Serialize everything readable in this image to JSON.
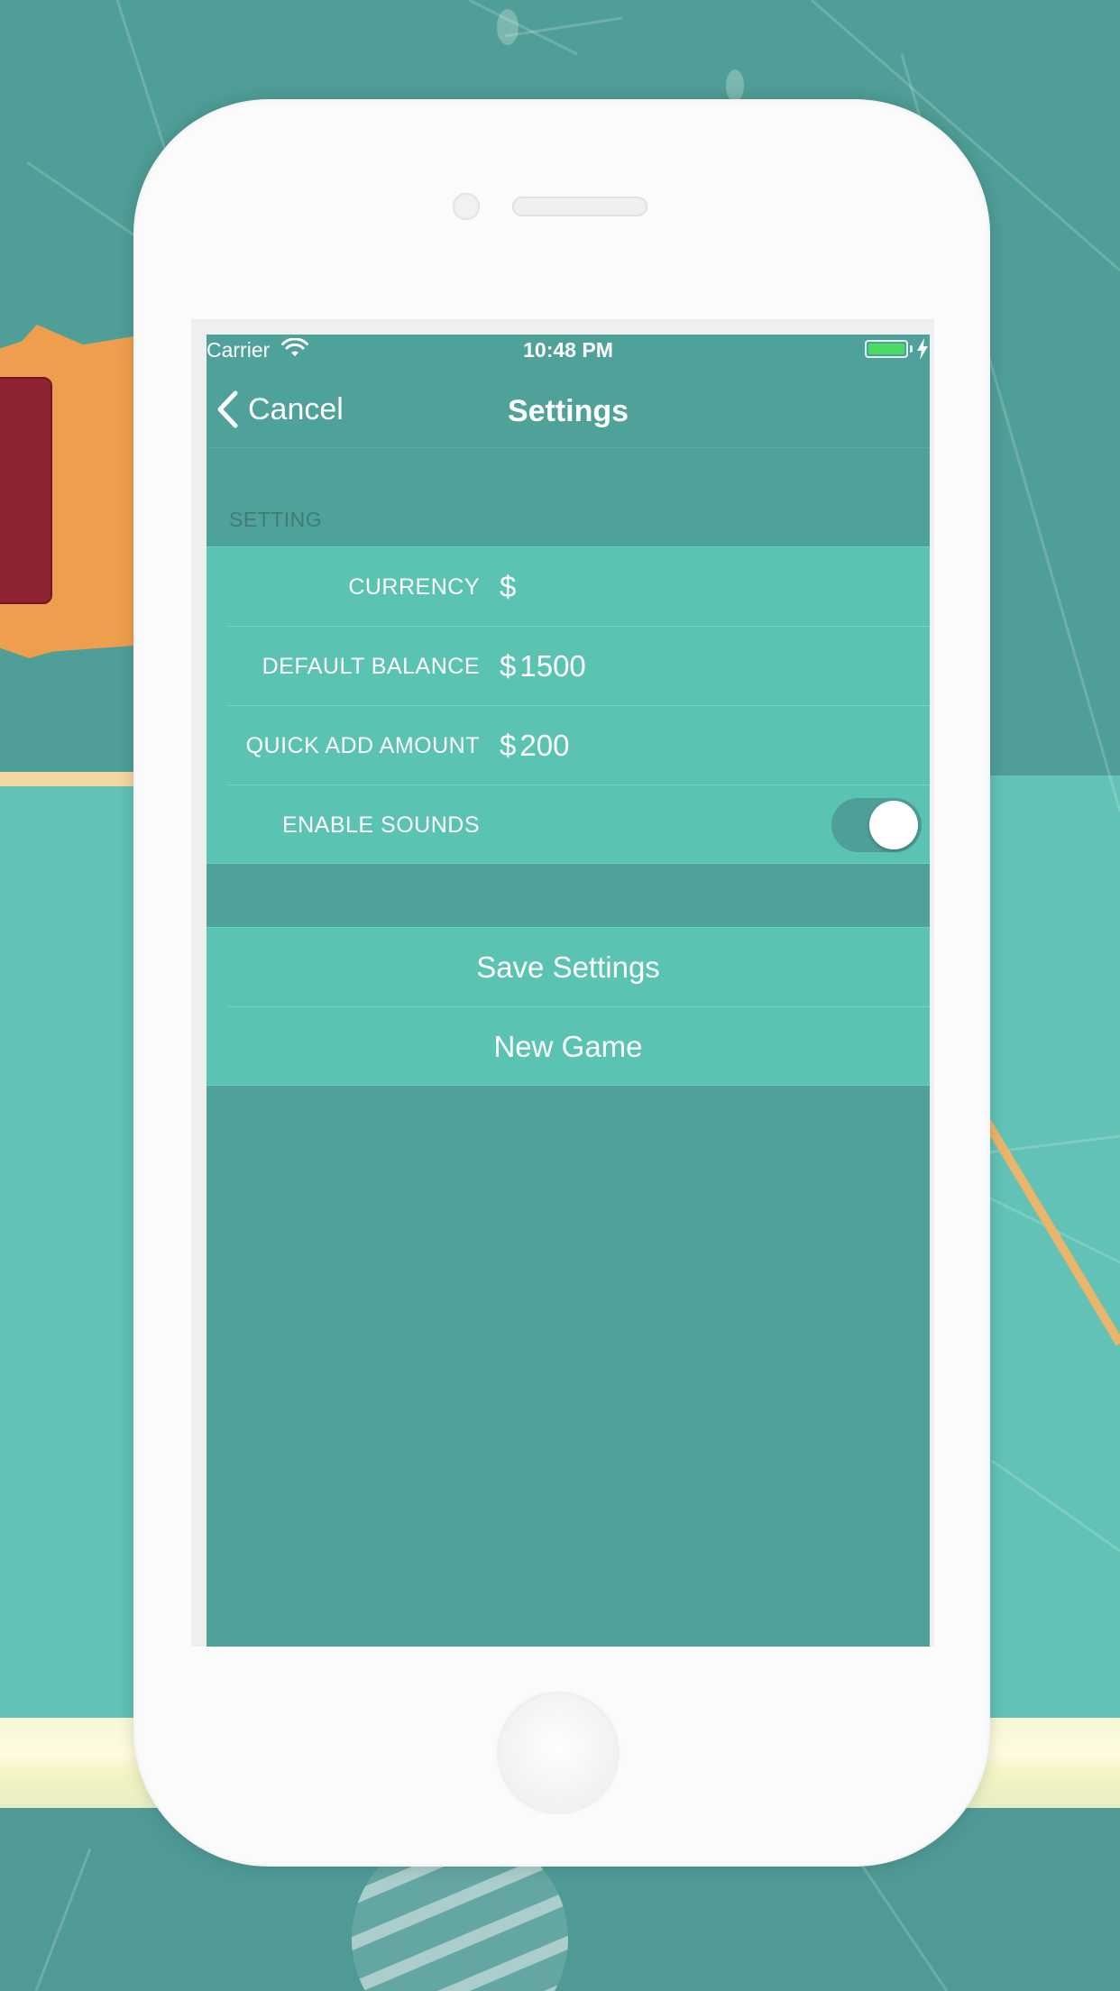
{
  "status_bar": {
    "carrier": "Carrier",
    "time": "10:48 PM",
    "battery_color": "#4cd964"
  },
  "nav": {
    "back_label": "Cancel",
    "title": "Settings"
  },
  "section": {
    "header": "SETTING"
  },
  "settings": {
    "currency": {
      "label": "CURRENCY",
      "value": "$"
    },
    "default_balance": {
      "label": "DEFAULT BALANCE",
      "currency": "$",
      "value": "1500"
    },
    "quick_add": {
      "label": "QUICK ADD AMOUNT",
      "currency": "$",
      "value": "200"
    },
    "sounds": {
      "label": "ENABLE SOUNDS",
      "enabled": true
    }
  },
  "actions": {
    "save": "Save Settings",
    "new_game": "New Game"
  },
  "colors": {
    "accent": "#5bc3b2",
    "screen_bg": "#4fa29a",
    "phone_body": "#fbfbfb"
  }
}
